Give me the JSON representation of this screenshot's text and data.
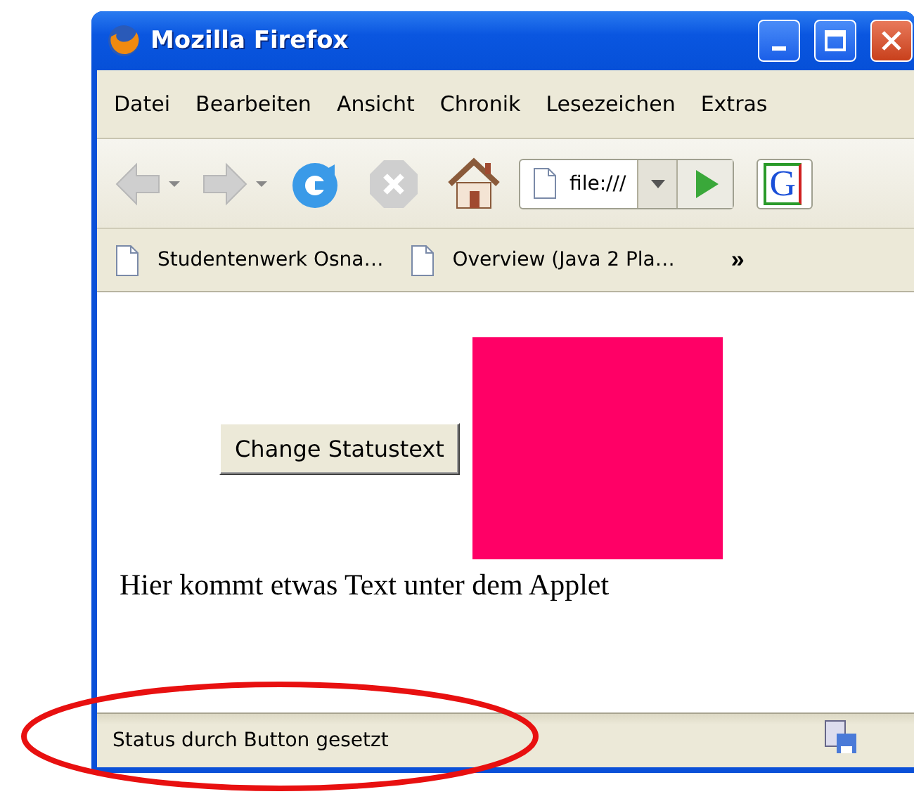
{
  "window": {
    "title": "Mozilla Firefox"
  },
  "menu": [
    {
      "label": "Datei"
    },
    {
      "label": "Bearbeiten"
    },
    {
      "label": "Ansicht"
    },
    {
      "label": "Chronik"
    },
    {
      "label": "Lesezeichen"
    },
    {
      "label": "Extras"
    }
  ],
  "toolbar": {
    "back_disabled": true,
    "forward_disabled": true,
    "stop_disabled": true,
    "url": "file:///",
    "search_engine_letter": "G"
  },
  "bookmarks": [
    {
      "label": "Studentenwerk Osna…"
    },
    {
      "label": "Overview (Java 2 Pla…"
    }
  ],
  "bookmarks_overflow": "»",
  "content": {
    "button": "Change Statustext",
    "text": "Hier kommt etwas Text unter dem Applet"
  },
  "status_bar": {
    "text": "Status durch Button gesetzt"
  }
}
